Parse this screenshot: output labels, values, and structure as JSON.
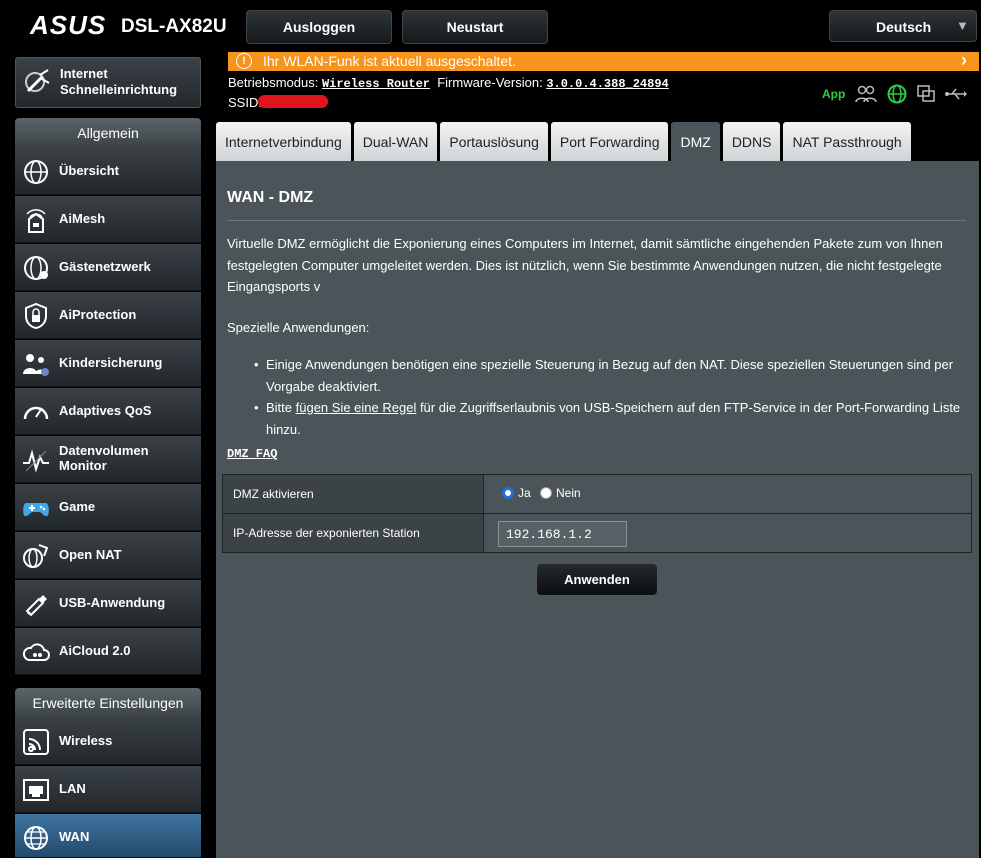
{
  "header": {
    "brand": "ASUS",
    "model": "DSL-AX82U",
    "logout_label": "Ausloggen",
    "restart_label": "Neustart",
    "language": "Deutsch"
  },
  "banner": {
    "text": "Ihr WLAN-Funk ist aktuell ausgeschaltet.",
    "color": "#f7941d"
  },
  "info": {
    "mode_label": "Betriebsmodus:",
    "mode_value": "Wireless Router",
    "firmware_label": "Firmware-Version:",
    "firmware_value": "3.0.0.4.388_24894",
    "ssid_label": "SSID:",
    "app_label": "App"
  },
  "sidebar": {
    "quick_setup": "Internet Schnelleinrichtung",
    "general_header": "Allgemein",
    "general_items": [
      {
        "label": "Übersicht",
        "icon": "globe-network-icon"
      },
      {
        "label": "AiMesh",
        "icon": "mesh-router-icon"
      },
      {
        "label": "Gästenetzwerk",
        "icon": "guest-network-icon"
      },
      {
        "label": "AiProtection",
        "icon": "shield-lock-icon"
      },
      {
        "label": "Kindersicherung",
        "icon": "family-icon"
      },
      {
        "label": "Adaptives QoS",
        "icon": "speedometer-icon"
      },
      {
        "label": "Datenvolumen Monitor",
        "icon": "traffic-monitor-icon"
      },
      {
        "label": "Game",
        "icon": "gamepad-icon"
      },
      {
        "label": "Open NAT",
        "icon": "open-nat-icon"
      },
      {
        "label": "USB-Anwendung",
        "icon": "usb-stick-icon"
      },
      {
        "label": "AiCloud 2.0",
        "icon": "cloud-icon"
      }
    ],
    "advanced_header": "Erweiterte Einstellungen",
    "advanced_items": [
      {
        "label": "Wireless",
        "icon": "wifi-icon"
      },
      {
        "label": "LAN",
        "icon": "lan-port-icon"
      },
      {
        "label": "WAN",
        "icon": "globe-icon",
        "active": true
      }
    ]
  },
  "tabs": [
    {
      "label": "Internetverbindung"
    },
    {
      "label": "Dual-WAN"
    },
    {
      "label": "Portauslösung"
    },
    {
      "label": "Port Forwarding"
    },
    {
      "label": "DMZ",
      "active": true
    },
    {
      "label": "DDNS"
    },
    {
      "label": "NAT Passthrough"
    }
  ],
  "content": {
    "title": "WAN - DMZ",
    "description": "Virtuelle DMZ ermöglicht die Exponierung eines Computers im Internet, damit sämtliche eingehenden Pakete zum von Ihnen festgelegten Computer umgeleitet werden. Dies ist nützlich, wenn Sie bestimmte Anwendungen nutzen, die nicht festgelegte Eingangsports v",
    "special_heading": "Spezielle Anwendungen:",
    "bullet1": "Einige Anwendungen benötigen eine spezielle Steuerung in Bezug auf den NAT. Diese speziellen Steuerungen sind per Vorgabe deaktiviert.",
    "bullet2_pre": "Bitte ",
    "bullet2_link": "fügen Sie eine Regel",
    "bullet2_post": " für die Zugriffserlaubnis von USB-Speichern auf den FTP-Service in der Port-Forwarding Liste hinzu.",
    "faq_link": "DMZ FAQ",
    "dmz_enable_label": "DMZ aktivieren",
    "yes_label": "Ja",
    "no_label": "Nein",
    "dmz_enabled": "Ja",
    "ip_label": "IP-Adresse der exponierten Station",
    "ip_value": "192.168.1.2",
    "apply_label": "Anwenden"
  }
}
